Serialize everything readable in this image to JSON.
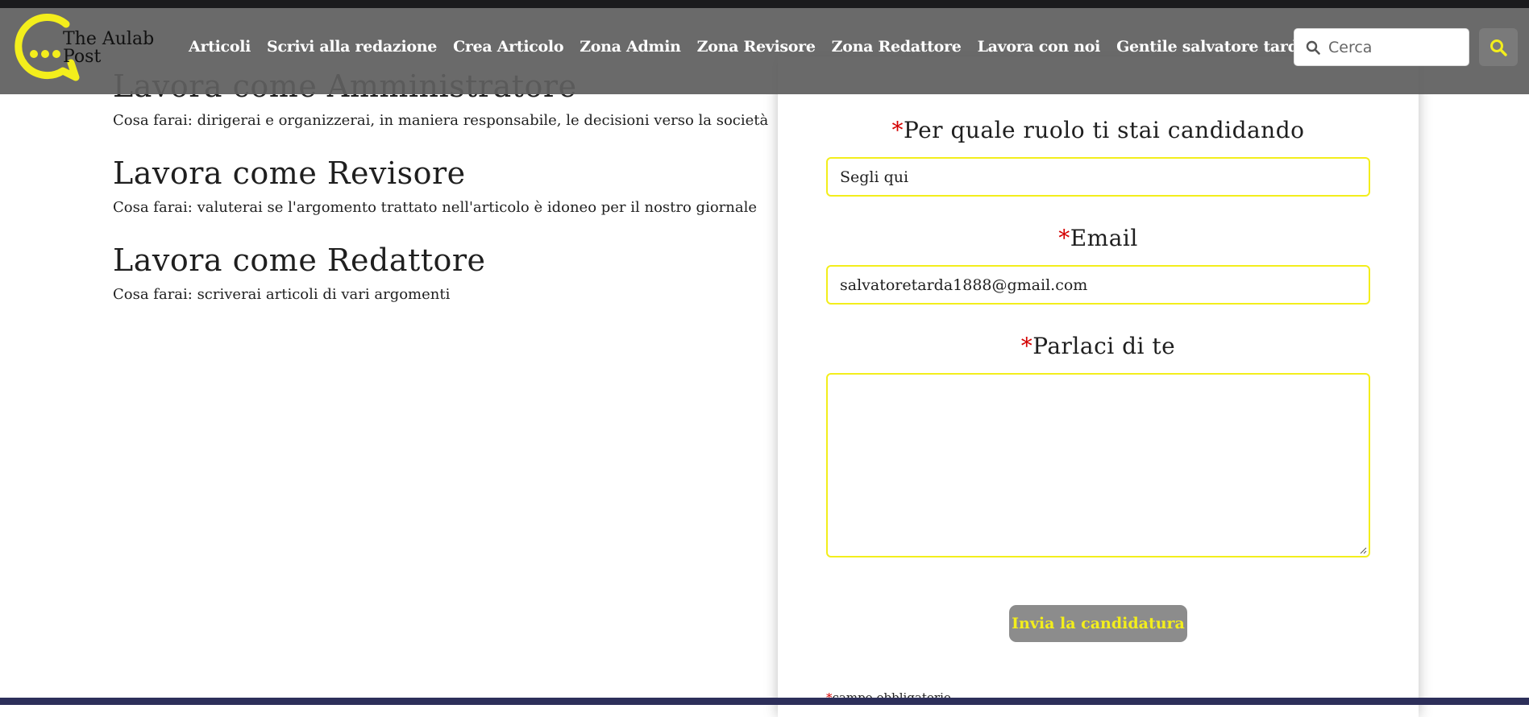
{
  "brand": {
    "line1": "The Aulab",
    "line2": "Post",
    "accent_color": "#f3ee1c"
  },
  "nav": {
    "items": [
      {
        "label": "Articoli"
      },
      {
        "label": "Scrivi alla redazione"
      },
      {
        "label": "Crea Articolo"
      },
      {
        "label": "Zona Admin"
      },
      {
        "label": "Zona Revisore"
      },
      {
        "label": "Zona Redattore"
      },
      {
        "label": "Lavora con noi"
      }
    ],
    "user_menu": "Gentile salvatore tarda",
    "search_placeholder": "Cerca",
    "search_icon": "search-icon"
  },
  "roles": [
    {
      "title": "Lavora come Amministratore",
      "desc": "Cosa farai: dirigerai e organizzerai, in maniera responsabile, le decisioni verso la società"
    },
    {
      "title": "Lavora come Revisore",
      "desc": "Cosa farai: valuterai se l'argomento trattato nell'articolo è idoneo per il nostro giornale"
    },
    {
      "title": "Lavora come Redattore",
      "desc": "Cosa farai: scriverai articoli di vari argomenti"
    }
  ],
  "form": {
    "required_mark": "*",
    "role_label": "Per quale ruolo ti stai candidando",
    "role_value": "Segli qui",
    "email_label": "Email",
    "email_value": "salvatoretarda1888@gmail.com",
    "about_label": "Parlaci di te",
    "about_value": "",
    "submit_label": "Invia la candidatura",
    "required_note": "campo obbligatorio"
  },
  "colors": {
    "navbar": "#5f5f5f",
    "accent": "#f3ee1c",
    "required": "#d40000",
    "footer": "#2d2f5a"
  }
}
